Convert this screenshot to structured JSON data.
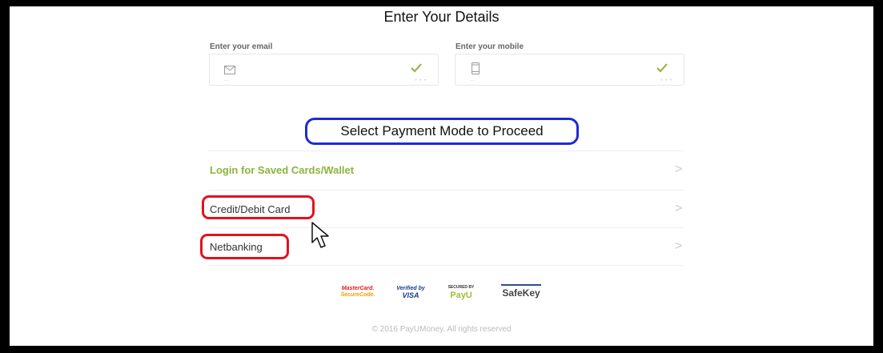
{
  "form": {
    "title": "Enter Your Details",
    "email": {
      "label": "Enter your email",
      "icon": "envelope-icon"
    },
    "mobile": {
      "label": "Enter your mobile",
      "icon": "mobile-phone-icon"
    }
  },
  "payment": {
    "heading": "Select Payment Mode to Proceed",
    "options": [
      {
        "label": "Login for Saved Cards/Wallet"
      },
      {
        "label": "Credit/Debit Card"
      },
      {
        "label": "Netbanking"
      }
    ]
  },
  "logos": {
    "mastercard_line1": "MasterCard.",
    "mastercard_line2": "SecureCode.",
    "visa_line1": "Verified by",
    "visa_line2": "VISA",
    "payu_line1": "SECURED BY",
    "payu_line2": "PayU",
    "safekey": "SafeKey"
  },
  "footer": {
    "text": "© 2016 PayUMoney. All rights reserved"
  },
  "colors": {
    "highlight_blue": "#1d2bd1",
    "highlight_red": "#e3121d",
    "accent_green": "#8db33b"
  }
}
